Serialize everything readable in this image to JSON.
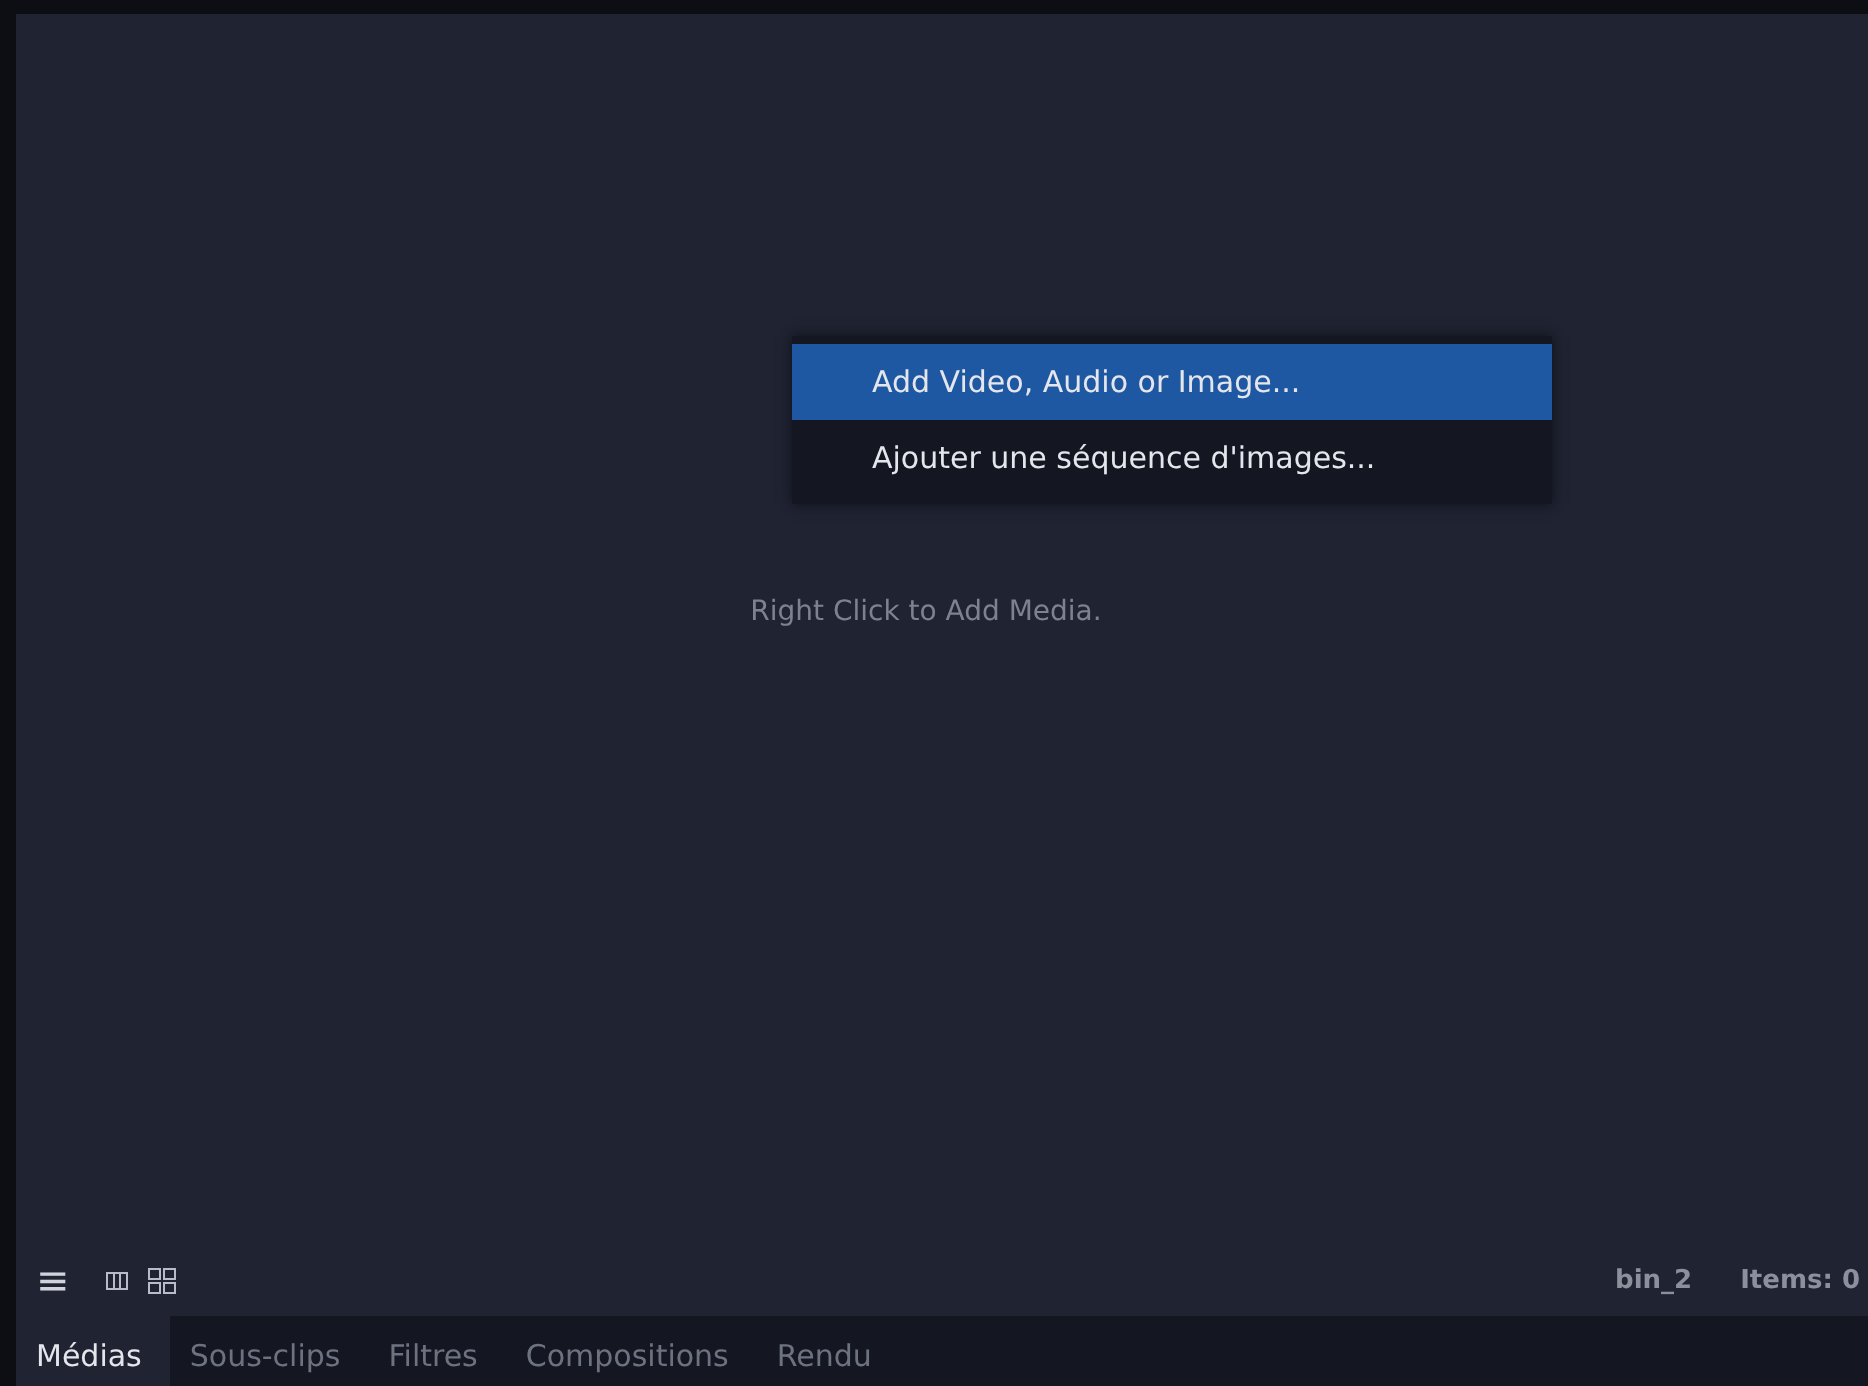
{
  "bin": {
    "empty_hint": "Right Click to Add Media."
  },
  "context_menu": {
    "items": [
      {
        "label": "Add Video, Audio or Image...",
        "selected": true
      },
      {
        "label": "Ajouter une séquence d'images...",
        "selected": false
      }
    ]
  },
  "toolbar": {
    "menu_icon": "≡",
    "bin_name": "bin_2",
    "items_count": "Items: 0"
  },
  "tabs": [
    {
      "label": "Médias",
      "selected": true
    },
    {
      "label": "Sous-clips",
      "selected": false
    },
    {
      "label": "Filtres",
      "selected": false
    },
    {
      "label": "Compositions",
      "selected": false
    },
    {
      "label": "Rendu",
      "selected": false
    }
  ]
}
